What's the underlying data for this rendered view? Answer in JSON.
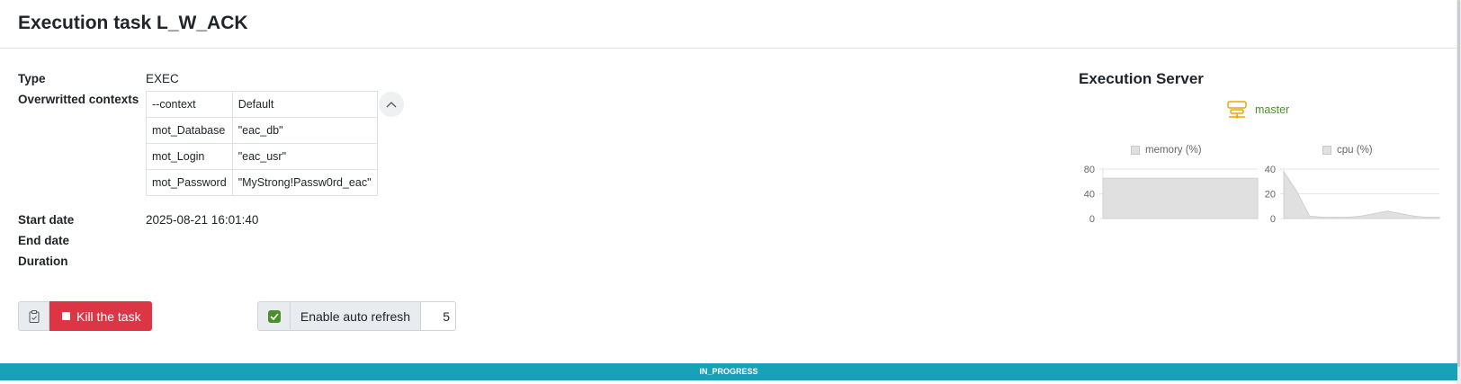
{
  "page": {
    "title": "Execution task L_W_ACK"
  },
  "details": {
    "type_label": "Type",
    "type_value": "EXEC",
    "contexts_label": "Overwritted contexts",
    "contexts": [
      {
        "key": "--context",
        "value": "Default"
      },
      {
        "key": "mot_Database",
        "value": "\"eac_db\""
      },
      {
        "key": "mot_Login",
        "value": "\"eac_usr\""
      },
      {
        "key": "mot_Password",
        "value": "\"MyStrong!Passw0rd_eac\""
      }
    ],
    "start_label": "Start date",
    "start_value": "2025-08-21 16:01:40",
    "end_label": "End date",
    "duration_label": "Duration"
  },
  "actions": {
    "kill_label": "Kill the task",
    "auto_refresh_label": "Enable auto refresh",
    "auto_refresh_value": "5",
    "auto_refresh_checked": true
  },
  "status": {
    "text": "IN_PROGRESS",
    "color": "#17a2b8"
  },
  "execution_server": {
    "title": "Execution Server",
    "server_name": "master",
    "server_icon": "server-network-icon",
    "accent": "#f0a500"
  },
  "chart_data": [
    {
      "type": "area",
      "series": [
        {
          "name": "memory (%)",
          "values": [
            65,
            65,
            65,
            65,
            65,
            65,
            65,
            65,
            65,
            65
          ]
        }
      ],
      "ylim": [
        0,
        80
      ],
      "yticks": [
        0,
        40,
        80
      ],
      "grid": true,
      "legend": "top"
    },
    {
      "type": "area",
      "series": [
        {
          "name": "cpu (%)",
          "values": [
            38,
            22,
            2,
            1,
            1,
            1,
            2,
            4,
            6,
            4,
            2,
            1,
            1
          ]
        }
      ],
      "ylim": [
        0,
        40
      ],
      "yticks": [
        0,
        20,
        40
      ],
      "grid": true,
      "legend": "top"
    }
  ]
}
